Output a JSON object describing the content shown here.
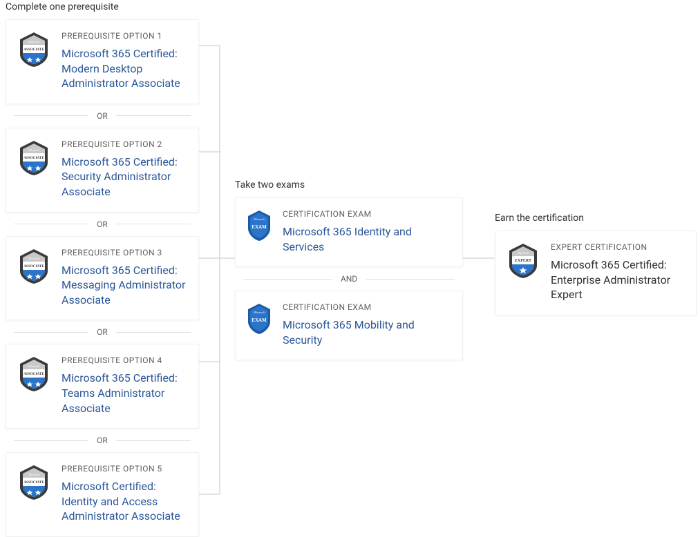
{
  "sections": {
    "prereq_label": "Complete one prerequisite",
    "exam_label": "Take two exams",
    "cert_label": "Earn the certification"
  },
  "separators": {
    "or": "OR",
    "and": "AND"
  },
  "prereqs": [
    {
      "eyebrow": "PREREQUISITE OPTION 1",
      "title": "Microsoft 365 Certified: Modern Desktop Administrator Associate"
    },
    {
      "eyebrow": "PREREQUISITE OPTION 2",
      "title": "Microsoft 365 Certified: Security Administrator Associate"
    },
    {
      "eyebrow": "PREREQUISITE OPTION 3",
      "title": "Microsoft 365 Certified: Messaging Administrator Associate"
    },
    {
      "eyebrow": "PREREQUISITE OPTION 4",
      "title": "Microsoft 365 Certified: Teams Administrator Associate"
    },
    {
      "eyebrow": "PREREQUISITE OPTION 5",
      "title": "Microsoft Certified: Identity and Access Administrator Associate"
    }
  ],
  "exams": [
    {
      "eyebrow": "CERTIFICATION EXAM",
      "title": "Microsoft 365 Identity and Services"
    },
    {
      "eyebrow": "CERTIFICATION EXAM",
      "title": "Microsoft 365 Mobility and Security"
    }
  ],
  "cert": {
    "eyebrow": "EXPERT CERTIFICATION",
    "title": "Microsoft 365 Certified: Enterprise Administrator Expert"
  },
  "badges": {
    "associate_label": "ASSOCIATE",
    "exam_label": "EXAM",
    "expert_label": "EXPERT"
  }
}
